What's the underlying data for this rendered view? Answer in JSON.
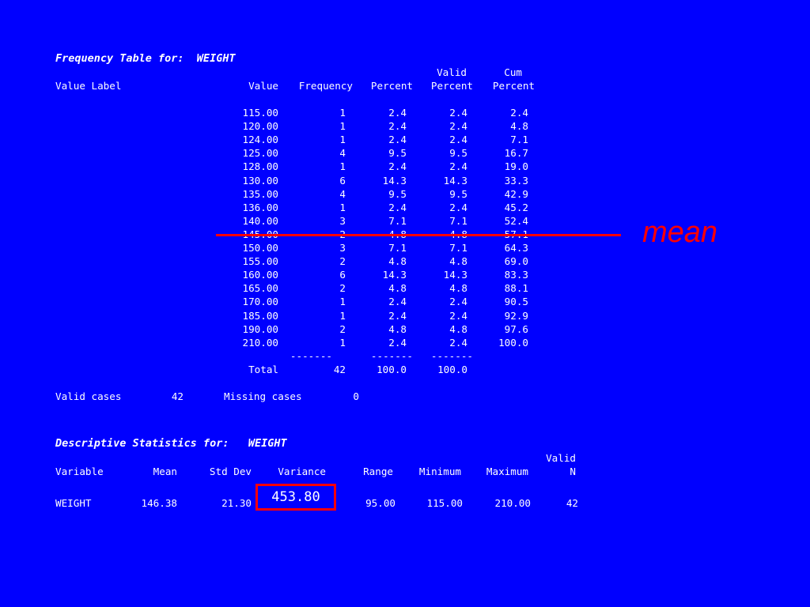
{
  "frequency_table": {
    "title": "Frequency Table for:  WEIGHT",
    "header_top": {
      "valid": "Valid",
      "cum": "Cum"
    },
    "header": {
      "value_label": "Value Label",
      "value": "Value",
      "frequency": "Frequency",
      "percent": "Percent",
      "valid_percent": "Percent",
      "cum_percent": "Percent"
    },
    "rows": [
      {
        "value": "115.00",
        "frequency": "1",
        "percent": "2.4",
        "valid_percent": "2.4",
        "cum_percent": "2.4"
      },
      {
        "value": "120.00",
        "frequency": "1",
        "percent": "2.4",
        "valid_percent": "2.4",
        "cum_percent": "4.8"
      },
      {
        "value": "124.00",
        "frequency": "1",
        "percent": "2.4",
        "valid_percent": "2.4",
        "cum_percent": "7.1"
      },
      {
        "value": "125.00",
        "frequency": "4",
        "percent": "9.5",
        "valid_percent": "9.5",
        "cum_percent": "16.7"
      },
      {
        "value": "128.00",
        "frequency": "1",
        "percent": "2.4",
        "valid_percent": "2.4",
        "cum_percent": "19.0"
      },
      {
        "value": "130.00",
        "frequency": "6",
        "percent": "14.3",
        "valid_percent": "14.3",
        "cum_percent": "33.3"
      },
      {
        "value": "135.00",
        "frequency": "4",
        "percent": "9.5",
        "valid_percent": "9.5",
        "cum_percent": "42.9"
      },
      {
        "value": "136.00",
        "frequency": "1",
        "percent": "2.4",
        "valid_percent": "2.4",
        "cum_percent": "45.2"
      },
      {
        "value": "140.00",
        "frequency": "3",
        "percent": "7.1",
        "valid_percent": "7.1",
        "cum_percent": "52.4"
      },
      {
        "value": "145.00",
        "frequency": "2",
        "percent": "4.8",
        "valid_percent": "4.8",
        "cum_percent": "57.1"
      },
      {
        "value": "150.00",
        "frequency": "3",
        "percent": "7.1",
        "valid_percent": "7.1",
        "cum_percent": "64.3"
      },
      {
        "value": "155.00",
        "frequency": "2",
        "percent": "4.8",
        "valid_percent": "4.8",
        "cum_percent": "69.0"
      },
      {
        "value": "160.00",
        "frequency": "6",
        "percent": "14.3",
        "valid_percent": "14.3",
        "cum_percent": "83.3"
      },
      {
        "value": "165.00",
        "frequency": "2",
        "percent": "4.8",
        "valid_percent": "4.8",
        "cum_percent": "88.1"
      },
      {
        "value": "170.00",
        "frequency": "1",
        "percent": "2.4",
        "valid_percent": "2.4",
        "cum_percent": "90.5"
      },
      {
        "value": "185.00",
        "frequency": "1",
        "percent": "2.4",
        "valid_percent": "2.4",
        "cum_percent": "92.9"
      },
      {
        "value": "190.00",
        "frequency": "2",
        "percent": "4.8",
        "valid_percent": "4.8",
        "cum_percent": "97.6"
      },
      {
        "value": "210.00",
        "frequency": "1",
        "percent": "2.4",
        "valid_percent": "2.4",
        "cum_percent": "100.0"
      }
    ],
    "separator": "-------",
    "total": {
      "label": "Total",
      "frequency": "42",
      "percent": "100.0",
      "valid_percent": "100.0"
    },
    "valid_cases_label": "Valid cases",
    "valid_cases": "42",
    "missing_cases_label": "Missing cases",
    "missing_cases": "0"
  },
  "annotation": {
    "mean_label": "mean",
    "color": "#ff0000"
  },
  "descriptive_stats": {
    "title": "Descriptive Statistics for:   WEIGHT",
    "header_top": {
      "valid": "Valid"
    },
    "header": {
      "variable": "Variable",
      "mean": "Mean",
      "std_dev": "Std Dev",
      "variance": "Variance",
      "range": "Range",
      "minimum": "Minimum",
      "maximum": "Maximum",
      "valid_n": "N"
    },
    "row": {
      "variable": "WEIGHT",
      "mean": "146.38",
      "std_dev": "21.30",
      "variance": "453.80",
      "range": "95.00",
      "minimum": "115.00",
      "maximum": "210.00",
      "valid_n": "42"
    }
  },
  "colors": {
    "background": "#0000ff",
    "text": "#ffffff",
    "highlight": "#ff0000"
  }
}
